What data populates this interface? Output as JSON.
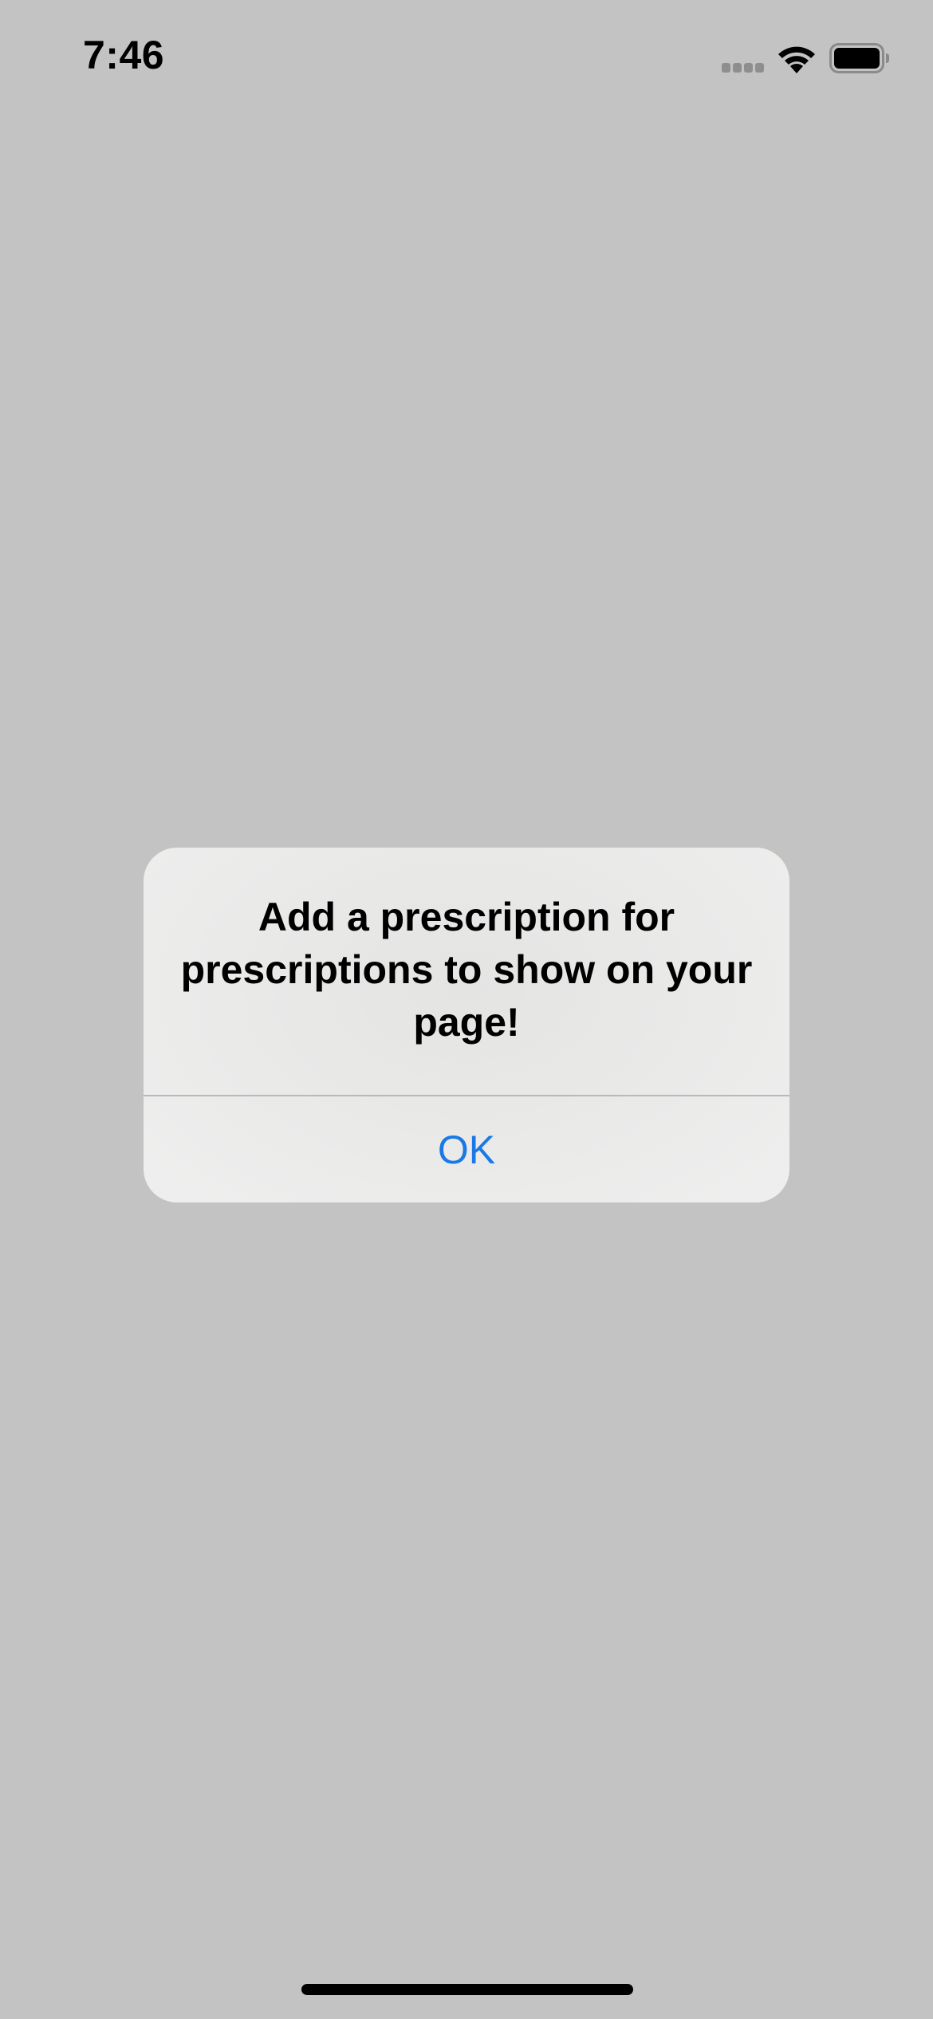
{
  "status_bar": {
    "time": "7:46",
    "icons": [
      "cellular-icon",
      "wifi-icon",
      "battery-icon"
    ]
  },
  "alert": {
    "message": "Add a prescription for prescriptions to show on your page!",
    "ok_label": "OK"
  },
  "colors": {
    "background": "#c3c3c3",
    "alert_background": "#ececec",
    "accent": "#1a79e6",
    "text": "#000000"
  }
}
